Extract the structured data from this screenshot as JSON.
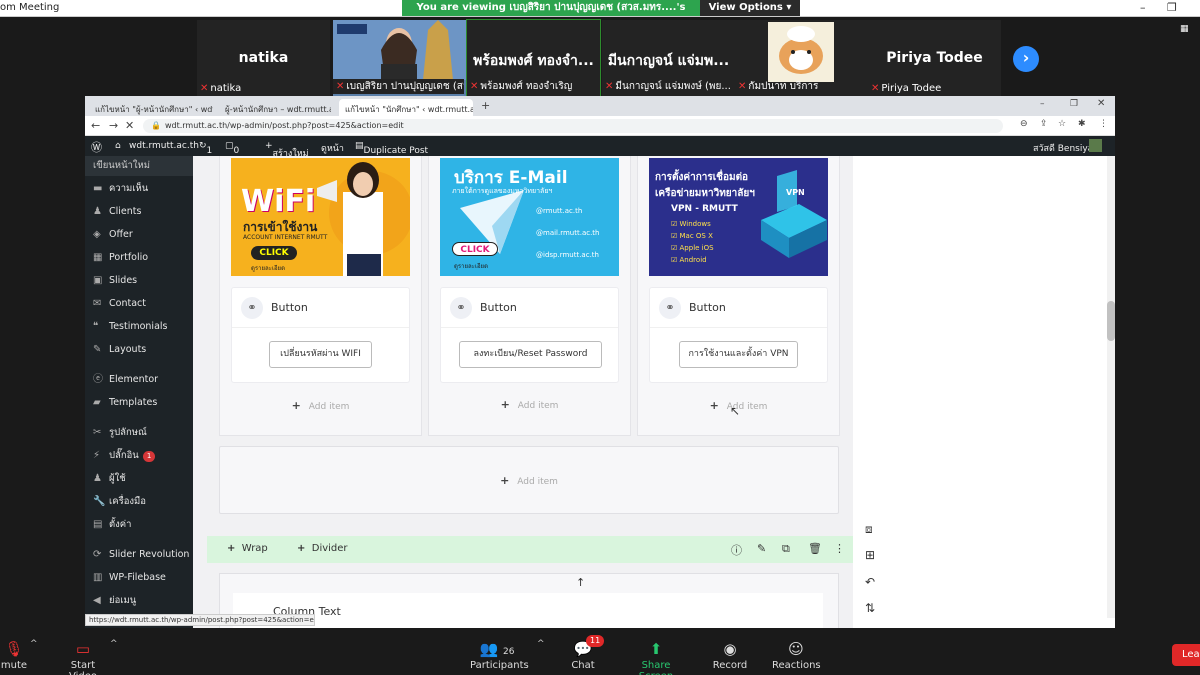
{
  "zoom": {
    "window_title": "om Meeting",
    "viewing_text": "You are viewing เบญสิริยา ปานปุญญเดช (สวส.มทร....'s screen",
    "view_options": "View Options",
    "participants_tiles": [
      {
        "big": "natika",
        "caption": "natika"
      },
      {
        "big": "",
        "caption": "เบญสิริยา ปานปุญญเดช (สวส..."
      },
      {
        "big": "พร้อมพงศ์ ทองจำ...",
        "caption": "พร้อมพงศ์ ทองจำเริญ"
      },
      {
        "big": "มีนกาญจน์ แจ่มพ...",
        "caption": "มีนกาญจน์ แจ่มพงษ์ (พย..."
      },
      {
        "big": "",
        "caption": "กัมปนาท บริการ"
      },
      {
        "big": "Piriya Todee",
        "caption": "Piriya Todee"
      }
    ],
    "toolbar": {
      "unmute": "mute",
      "start_video": "Start Video",
      "participants": "Participants",
      "participants_count": "26",
      "chat": "Chat",
      "chat_count": "11",
      "share_screen": "Share Screen",
      "record": "Record",
      "reactions": "Reactions",
      "leave": "Lea"
    }
  },
  "browser": {
    "tabs": [
      "แก้ไขหน้า \"ผู้-หน้านักศึกษา\" ‹ wdt.r...",
      "ผู้-หน้านักศึกษา – wdt.rmutt.ac.th",
      "แก้ไขหน้า \"นักศึกษา\" ‹ wdt.rmutt.ac..."
    ],
    "url": "wdt.rmutt.ac.th/wp-admin/post.php?post=425&action=edit",
    "status_url": "https://wdt.rmutt.ac.th/wp-admin/post.php?post=425&action=edit"
  },
  "wp": {
    "adminbar": {
      "site": "wdt.rmutt.ac.th",
      "updates": "1",
      "comments": "0",
      "new": "สร้างใหม่",
      "view": "ดูหน้า",
      "duplicate": "Duplicate Post",
      "greeting": "สวัสดี Bensiya"
    },
    "sidebar": [
      {
        "label": "เขียนหน้าใหม่",
        "icon": "page-icon",
        "head": true
      },
      {
        "label": "ความเห็น",
        "icon": "comment-icon"
      },
      {
        "label": "Clients",
        "icon": "clients-icon"
      },
      {
        "label": "Offer",
        "icon": "offer-icon"
      },
      {
        "label": "Portfolio",
        "icon": "portfolio-icon"
      },
      {
        "label": "Slides",
        "icon": "slides-icon"
      },
      {
        "label": "Contact",
        "icon": "mail-icon"
      },
      {
        "label": "Testimonials",
        "icon": "quote-icon"
      },
      {
        "label": "Layouts",
        "icon": "brush-icon"
      },
      {
        "label": "Elementor",
        "icon": "elementor-icon"
      },
      {
        "label": "Templates",
        "icon": "folder-icon"
      },
      {
        "label": "รูปลักษณ์",
        "icon": "appearance-icon"
      },
      {
        "label": "ปลั๊กอิน",
        "icon": "plugin-icon",
        "badge": "1"
      },
      {
        "label": "ผู้ใช้",
        "icon": "user-icon"
      },
      {
        "label": "เครื่องมือ",
        "icon": "wrench-icon"
      },
      {
        "label": "ตั้งค่า",
        "icon": "settings-icon"
      },
      {
        "label": "Slider Revolution",
        "icon": "slider-icon"
      },
      {
        "label": "WP-Filebase",
        "icon": "file-icon"
      },
      {
        "label": "ย่อเมนู",
        "icon": "collapse-icon"
      }
    ],
    "columns": [
      {
        "banner": {
          "title": "WiFi",
          "sub": "การเข้าใช้งาน",
          "sub2": "ACCOUNT INTERNET RMUTT",
          "click": "CLICK",
          "more": "ดูรายละเอียด"
        },
        "button_label": "Button",
        "button_text": "เปลี่ยนรหัสผ่าน WIFI",
        "add": "Add item"
      },
      {
        "banner": {
          "title": "บริการ E-Mail",
          "sub": "ภายใต้การดูแลของมหาวิทยาลัยฯ",
          "lines": [
            "@rmutt.ac.th",
            "@mail.rmutt.ac.th",
            "@idsp.rmutt.ac.th"
          ],
          "click": "CLICK",
          "more": "ดูรายละเอียด"
        },
        "button_label": "Button",
        "button_text": "ลงทะเบียน/Reset Password",
        "add": "Add item"
      },
      {
        "banner": {
          "title": "การตั้งค่าการเชื่อมต่อ",
          "title2": "เครือข่ายมหาวิทยาลัยฯ",
          "sub": "VPN - RMUTT",
          "lines": [
            "Windows",
            "Mac OS X",
            "Apple iOS",
            "Android"
          ],
          "badge": "VPN"
        },
        "button_label": "Button",
        "button_text": "การใช้งานและตั้งค่า VPN",
        "add": "Add item"
      }
    ],
    "empty_add": "Add item",
    "wrap": "Wrap",
    "divider": "Divider",
    "column_text": "Column Text"
  }
}
